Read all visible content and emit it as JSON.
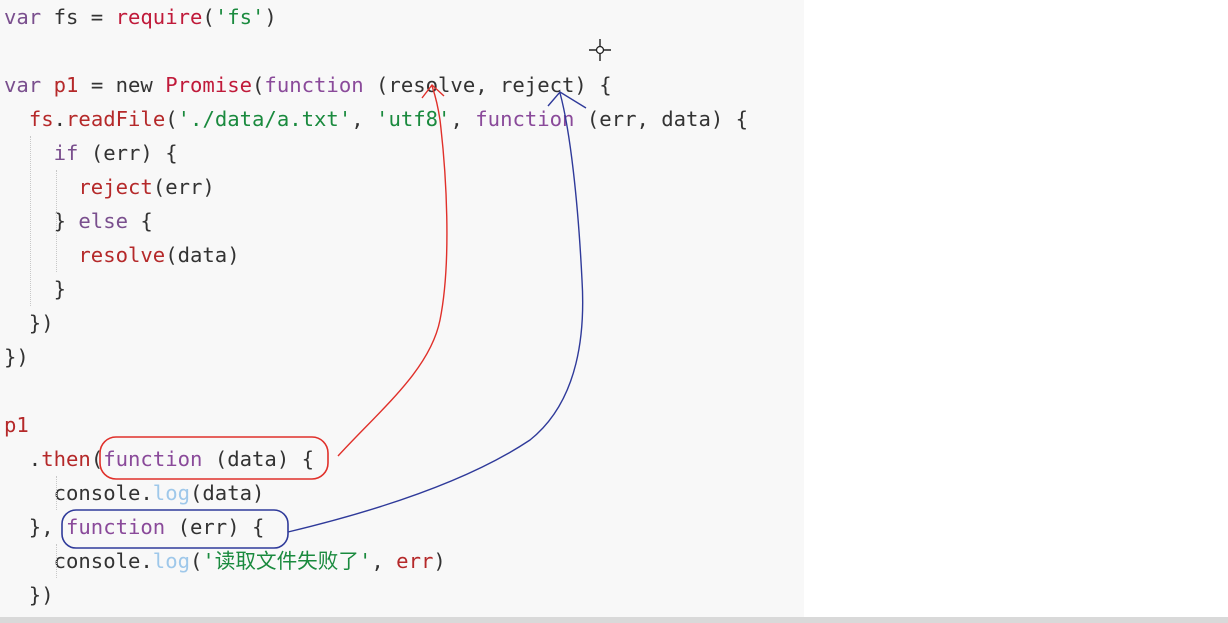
{
  "lines": [
    {
      "indent": 0,
      "tokens": [
        [
          "kw",
          "var"
        ],
        [
          "t",
          " fs = "
        ],
        [
          "cls",
          "require"
        ],
        [
          "t",
          "("
        ],
        [
          "str",
          "'fs'"
        ],
        [
          "t",
          ")"
        ]
      ]
    },
    {
      "indent": 0,
      "tokens": []
    },
    {
      "indent": 0,
      "tokens": [
        [
          "kw",
          "var"
        ],
        [
          "t",
          " "
        ],
        [
          "var",
          "p1"
        ],
        [
          "t",
          " = new "
        ],
        [
          "cls",
          "Promise"
        ],
        [
          "t",
          "("
        ],
        [
          "fn",
          "function"
        ],
        [
          "t",
          " (resolve, reject) {"
        ]
      ]
    },
    {
      "indent": 0,
      "tokens": [
        [
          "t",
          "  "
        ],
        [
          "var",
          "fs"
        ],
        [
          "t",
          "."
        ],
        [
          "var",
          "readFile"
        ],
        [
          "t",
          "("
        ],
        [
          "str",
          "'./data/a.txt'"
        ],
        [
          "t",
          ", "
        ],
        [
          "str",
          "'utf8'"
        ],
        [
          "t",
          ", "
        ],
        [
          "fn",
          "function"
        ],
        [
          "t",
          " (err, data) {"
        ]
      ]
    },
    {
      "indent": 0,
      "tokens": [
        [
          "t",
          "    "
        ],
        [
          "kw",
          "if"
        ],
        [
          "t",
          " (err) {"
        ]
      ]
    },
    {
      "indent": 0,
      "tokens": [
        [
          "t",
          "      "
        ],
        [
          "var",
          "reject"
        ],
        [
          "t",
          "(err)"
        ]
      ]
    },
    {
      "indent": 0,
      "tokens": [
        [
          "t",
          "    } "
        ],
        [
          "kw",
          "else"
        ],
        [
          "t",
          " {"
        ]
      ]
    },
    {
      "indent": 0,
      "tokens": [
        [
          "t",
          "      "
        ],
        [
          "var",
          "resolve"
        ],
        [
          "t",
          "(data)"
        ]
      ]
    },
    {
      "indent": 0,
      "tokens": [
        [
          "t",
          "    }"
        ]
      ]
    },
    {
      "indent": 0,
      "tokens": [
        [
          "t",
          "  })"
        ]
      ]
    },
    {
      "indent": 0,
      "tokens": [
        [
          "t",
          "})"
        ]
      ]
    },
    {
      "indent": 0,
      "tokens": []
    },
    {
      "indent": 0,
      "tokens": [
        [
          "var",
          "p1"
        ]
      ]
    },
    {
      "indent": 0,
      "tokens": [
        [
          "t",
          "  ."
        ],
        [
          "var",
          "then"
        ],
        [
          "t",
          "("
        ],
        [
          "fn",
          "function"
        ],
        [
          "t",
          " (data) {"
        ]
      ]
    },
    {
      "indent": 0,
      "tokens": [
        [
          "t",
          "    console."
        ],
        [
          "log",
          "log"
        ],
        [
          "t",
          "(data)"
        ]
      ]
    },
    {
      "indent": 0,
      "tokens": [
        [
          "t",
          "  }, "
        ],
        [
          "fn",
          "function"
        ],
        [
          "t",
          " (err) {"
        ]
      ]
    },
    {
      "indent": 0,
      "tokens": [
        [
          "t",
          "    console."
        ],
        [
          "log",
          "log"
        ],
        [
          "t",
          "("
        ],
        [
          "str",
          "'读取文件失败了'"
        ],
        [
          "t",
          ", "
        ],
        [
          "var",
          "err"
        ],
        [
          "t",
          ")"
        ]
      ]
    },
    {
      "indent": 0,
      "tokens": [
        [
          "t",
          "  })"
        ]
      ]
    }
  ],
  "colors": {
    "editor_bg": "#f8f8f8",
    "keyword": "#7a4f8e",
    "variable": "#b5292a",
    "string": "#1a8a3e",
    "class": "#c01a3a",
    "function_kw": "#8a4a9a",
    "log": "#9fc8ea",
    "annotation_red": "#e0302a",
    "annotation_blue": "#2f3a9a"
  },
  "icons": {
    "cursor": "crosshair-cursor-icon"
  }
}
